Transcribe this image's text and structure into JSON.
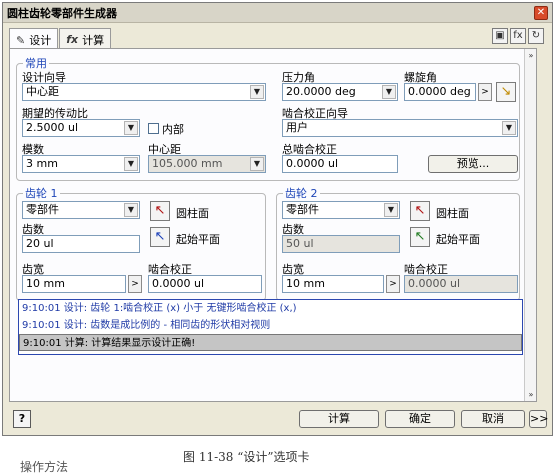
{
  "window": {
    "title": "圆柱齿轮零部件生成器",
    "close_glyph": "✕"
  },
  "tabs": [
    {
      "icon": "✎",
      "label": "设计"
    },
    {
      "icon": "fx",
      "label": "计算"
    }
  ],
  "toolbar": {
    "icons": [
      "config-icon",
      "formula-icon",
      "refresh-icon"
    ],
    "glyphs": [
      "▣",
      "fx",
      "↻"
    ]
  },
  "common": {
    "legend": "常用",
    "design_guide": {
      "label": "设计向导",
      "value": "中心距"
    },
    "ratio": {
      "label": "期望的传动比",
      "value": "2.5000 ul",
      "internal_label": "内部"
    },
    "module": {
      "label": "模数",
      "value": "3 mm"
    },
    "center_distance": {
      "label": "中心距",
      "value": "105.000 mm"
    },
    "pressure_angle": {
      "label": "压力角",
      "value": "20.0000 deg"
    },
    "helix_angle": {
      "label": "螺旋角",
      "value": "0.0000 deg"
    },
    "mesh_guide": {
      "label": "啮合校正向导",
      "value": "用户"
    },
    "total_correction": {
      "label": "总啮合校正",
      "value": "0.0000 ul"
    },
    "preview_label": "预览..."
  },
  "gear1": {
    "legend": "齿轮 1",
    "type": "零部件",
    "cyl_face": "圆柱面",
    "start_plane": "起始平面",
    "teeth": {
      "label": "齿数",
      "value": "20 ul"
    },
    "width": {
      "label": "齿宽",
      "value": "10 mm"
    },
    "correction": {
      "label": "啮合校正",
      "value": "0.0000 ul"
    }
  },
  "gear2": {
    "legend": "齿轮 2",
    "type": "零部件",
    "cyl_face": "圆柱面",
    "start_plane": "起始平面",
    "teeth": {
      "label": "齿数",
      "value": "50 ul"
    },
    "width": {
      "label": "齿宽",
      "value": "10 mm"
    },
    "correction": {
      "label": "啮合校正",
      "value": "0.0000 ul"
    }
  },
  "messages": [
    "9:10:01 设计: 齿轮 1:啮合校正 (x) 小于 无键形啮合校正 (x,)",
    "9:10:01 设计: 齿数是成比例的 - 相同齿的形状相对视则",
    "9:10:01 计算: 计算结果显示设计正确!"
  ],
  "footer": {
    "help": "?",
    "calc": "计算",
    "ok": "确定",
    "cancel": "取消",
    "more": ">>"
  },
  "caption": "图 11-38 “设计”选项卡",
  "side_text": "操作方法"
}
